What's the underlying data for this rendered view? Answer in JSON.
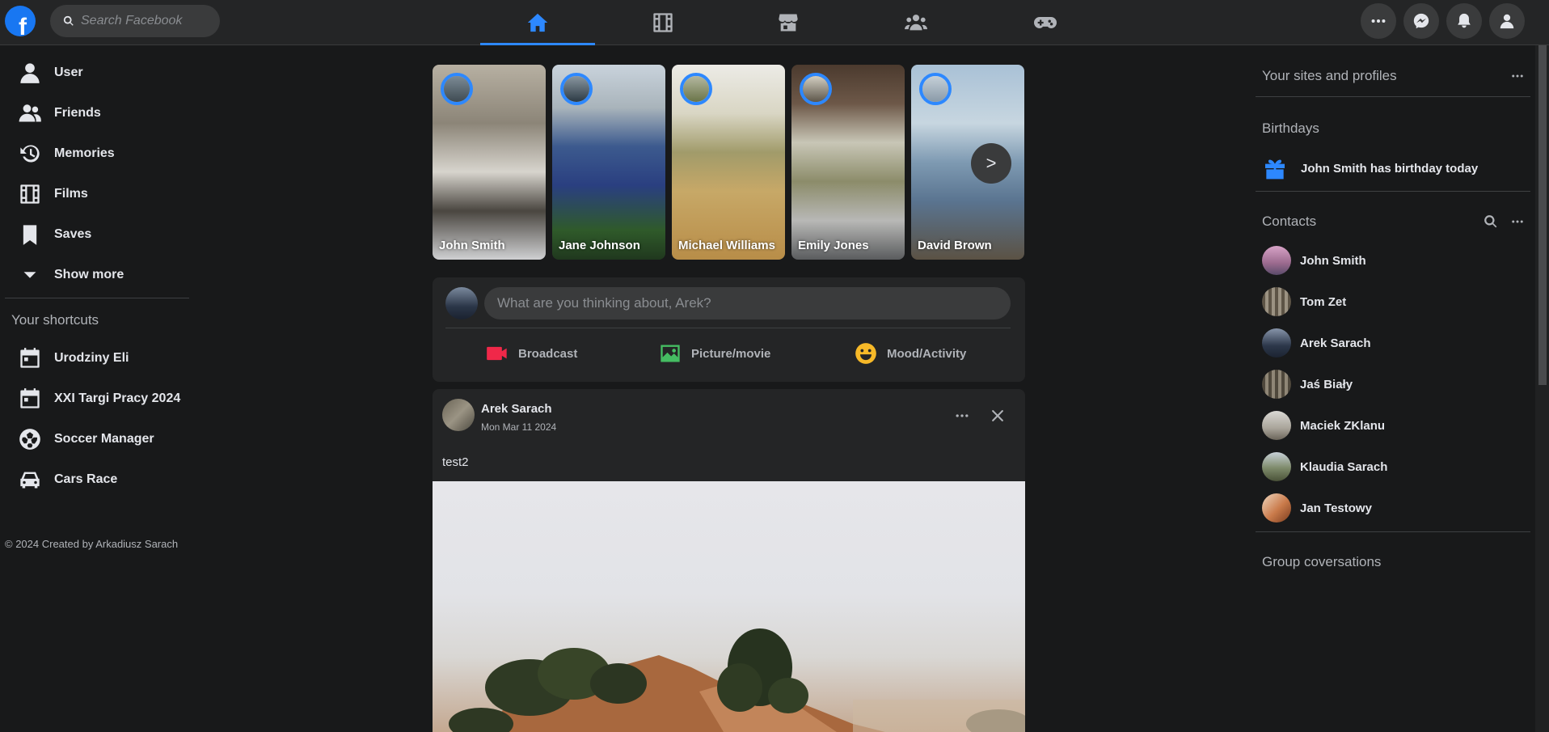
{
  "header": {
    "logo_letter": "f",
    "search_placeholder": "Search Facebook",
    "nav_tabs": [
      {
        "icon": "home-icon",
        "active": true
      },
      {
        "icon": "video-icon",
        "active": false
      },
      {
        "icon": "marketplace-icon",
        "active": false
      },
      {
        "icon": "groups-icon",
        "active": false
      },
      {
        "icon": "gaming-icon",
        "active": false
      }
    ],
    "actions": [
      "menu-dots-icon",
      "messenger-icon",
      "notifications-icon",
      "account-icon"
    ]
  },
  "sidebar": {
    "items": [
      {
        "label": "User",
        "icon": "user-icon"
      },
      {
        "label": "Friends",
        "icon": "friends-icon"
      },
      {
        "label": "Memories",
        "icon": "memories-icon"
      },
      {
        "label": "Films",
        "icon": "film-icon"
      },
      {
        "label": "Saves",
        "icon": "bookmark-icon"
      },
      {
        "label": "Show more",
        "icon": "chevron-down-icon"
      }
    ],
    "shortcuts_heading": "Your shortcuts",
    "shortcuts": [
      {
        "label": "Urodziny Eli",
        "icon": "calendar-icon"
      },
      {
        "label": "XXI Targi Pracy 2024",
        "icon": "calendar-icon"
      },
      {
        "label": "Soccer Manager",
        "icon": "soccer-ball-icon"
      },
      {
        "label": "Cars Race",
        "icon": "car-icon"
      }
    ],
    "footer": "© 2024 Created by Arkadiusz Sarach"
  },
  "stories": {
    "items": [
      {
        "name": "John Smith"
      },
      {
        "name": "Jane Johnson"
      },
      {
        "name": "Michael Williams"
      },
      {
        "name": "Emily Jones"
      },
      {
        "name": "David Brown"
      }
    ],
    "next_label": ">"
  },
  "composer": {
    "placeholder": "What are you thinking about, Arek?",
    "actions": [
      {
        "label": "Broadcast",
        "icon": "video-camera-icon",
        "color": "#f02849"
      },
      {
        "label": "Picture/movie",
        "icon": "photo-icon",
        "color": "#45bd62"
      },
      {
        "label": "Mood/Activity",
        "icon": "smiley-icon",
        "color": "#f7b928"
      }
    ]
  },
  "post": {
    "author": "Arek Sarach",
    "date": "Mon Mar 11 2024",
    "text": "test2"
  },
  "right": {
    "sites_heading": "Your sites and profiles",
    "birthdays_heading": "Birthdays",
    "birthday_text": "John Smith has birthday today",
    "contacts_heading": "Contacts",
    "contacts": [
      {
        "name": "John Smith"
      },
      {
        "name": "Tom Zet"
      },
      {
        "name": "Arek Sarach"
      },
      {
        "name": "Jaś Biały"
      },
      {
        "name": "Maciek ZKlanu"
      },
      {
        "name": "Klaudia Sarach"
      },
      {
        "name": "Jan Testowy"
      }
    ],
    "group_heading": "Group coversations"
  },
  "colors": {
    "accent": "#2d88ff",
    "background": "#18191a",
    "surface": "#242526"
  }
}
